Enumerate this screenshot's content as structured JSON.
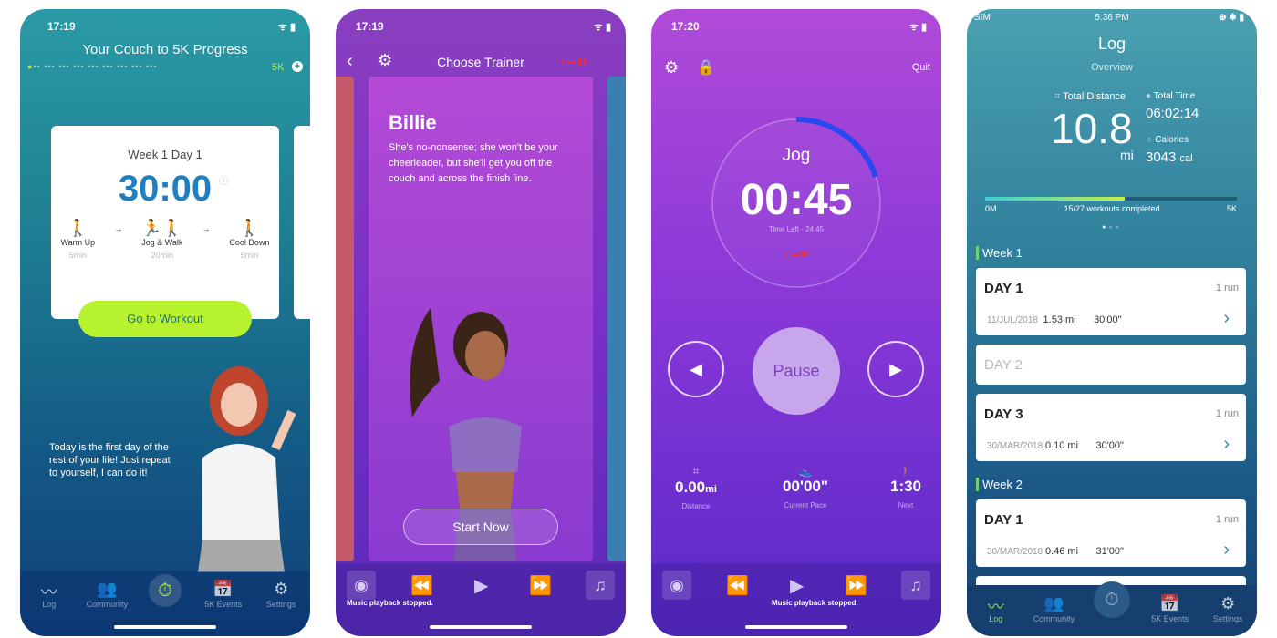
{
  "screen1": {
    "time": "17:19",
    "title": "Your Couch to 5K Progress",
    "goal": "5K",
    "card": {
      "heading": "Week 1 Day 1",
      "duration": "30:00",
      "steps": [
        {
          "label": "Warm Up",
          "time": "5min"
        },
        {
          "label": "Jog & Walk",
          "time": "20min"
        },
        {
          "label": "Cool Down",
          "time": "5min"
        }
      ],
      "button": "Go to Workout"
    },
    "quote": "Today is the first day of the rest of your life! Just repeat to yourself, I can do it!",
    "tabs": [
      "Log",
      "Community",
      "",
      "5K Events",
      "Settings"
    ],
    "accent": "#b6f22e"
  },
  "screen2": {
    "time": "17:19",
    "title": "Choose Trainer",
    "trainer_name": "Billie",
    "trainer_desc": "She's no-nonsense; she won't be your cheerleader, but she'll get you off the couch and across the finish line.",
    "button": "Start Now",
    "music_status": "Music playback stopped."
  },
  "screen3": {
    "time": "17:20",
    "quit": "Quit",
    "phase": "Jog",
    "elapsed": "00:45",
    "time_left": "Time Left - 24:45",
    "pause": "Pause",
    "stats": [
      {
        "value": "0.00",
        "unit": "mi",
        "label": "Distance"
      },
      {
        "value": "00'00\"",
        "unit": "",
        "label": "Current Pace"
      },
      {
        "value": "1:30",
        "unit": "",
        "label": "Next"
      }
    ],
    "music_status": "Music playback stopped."
  },
  "screen4": {
    "carrier": "SIM",
    "time": "5:36 PM",
    "title": "Log",
    "subtitle": "Overview",
    "total_distance_label": "Total Distance",
    "total_distance": "10.8",
    "distance_unit": "mi",
    "total_time_label": "Total Time",
    "total_time": "06:02:14",
    "calories_label": "Calories",
    "calories": "3043",
    "calories_unit": "cal",
    "progress": {
      "start": "0M",
      "end": "5K",
      "label": "15/27 workouts completed",
      "fraction": 0.556
    },
    "weeks": [
      {
        "label": "Week 1",
        "days": [
          {
            "day": "DAY 1",
            "runs": "1 run",
            "date": "11/JUL/2018",
            "dist": "1.53 mi",
            "dur": "30'00\""
          },
          {
            "day": "DAY 2"
          },
          {
            "day": "DAY 3",
            "runs": "1 run",
            "date": "30/MAR/2018",
            "dist": "0.10 mi",
            "dur": "30'00\""
          }
        ]
      },
      {
        "label": "Week 2",
        "days": [
          {
            "day": "DAY 1",
            "runs": "1 run",
            "date": "30/MAR/2018",
            "dist": "0.46 mi",
            "dur": "31'00\""
          }
        ]
      }
    ],
    "tabs": [
      "Log",
      "Community",
      "",
      "5K Events",
      "Settings"
    ]
  }
}
